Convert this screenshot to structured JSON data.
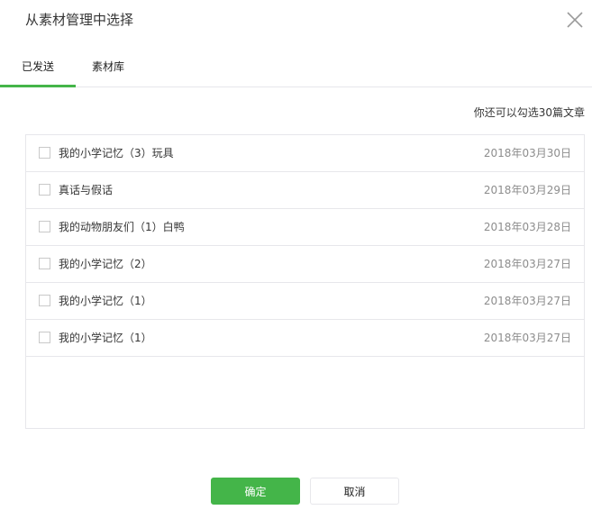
{
  "dialog": {
    "title": "从素材管理中选择",
    "close_icon": "close-icon"
  },
  "tabs": [
    {
      "label": "已发送",
      "active": true
    },
    {
      "label": "素材库",
      "active": false
    }
  ],
  "hint": "你还可以勾选30篇文章",
  "articles": [
    {
      "title": "我的小学记忆（3）玩具",
      "date": "2018年03月30日",
      "checked": false
    },
    {
      "title": "真话与假话",
      "date": "2018年03月29日",
      "checked": false
    },
    {
      "title": "我的动物朋友们（1）白鸭",
      "date": "2018年03月28日",
      "checked": false
    },
    {
      "title": "我的小学记忆（2）",
      "date": "2018年03月27日",
      "checked": false
    },
    {
      "title": "我的小学记忆（1）",
      "date": "2018年03月27日",
      "checked": false
    },
    {
      "title": "我的小学记忆（1）",
      "date": "2018年03月27日",
      "checked": false
    }
  ],
  "buttons": {
    "confirm": "确定",
    "cancel": "取消"
  },
  "colors": {
    "accent": "#44b549",
    "border": "#e7e7eb"
  }
}
